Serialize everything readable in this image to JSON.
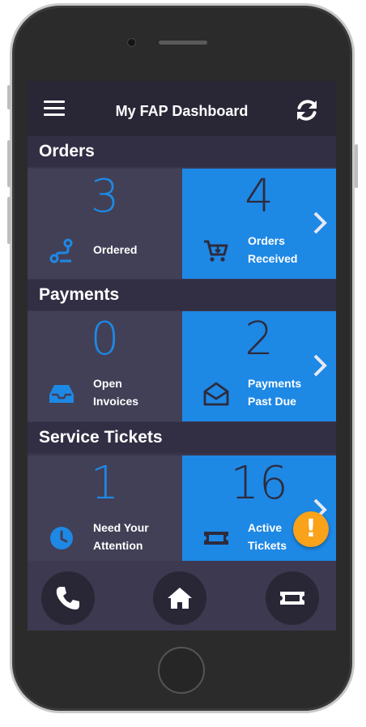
{
  "header": {
    "title": "My FAP Dashboard"
  },
  "sections": [
    {
      "title": "Orders",
      "left": {
        "count": "3",
        "label_line1": "Ordered",
        "label_line2": ""
      },
      "right": {
        "count": "4",
        "label_line1": "Orders",
        "label_line2": "Received"
      }
    },
    {
      "title": "Payments",
      "left": {
        "count": "0",
        "label_line1": "Open",
        "label_line2": "Invoices"
      },
      "right": {
        "count": "2",
        "label_line1": "Payments",
        "label_line2": "Past Due"
      }
    },
    {
      "title": "Service Tickets",
      "left": {
        "count": "1",
        "label_line1": "Need Your",
        "label_line2": "Attention"
      },
      "right": {
        "count": "16",
        "label_line1": "Active",
        "label_line2": "Tickets"
      }
    }
  ],
  "fab": {
    "glyph": "!"
  },
  "colors": {
    "accent_blue": "#1e88e5",
    "header_bg": "#292636",
    "tile_dark": "#424056",
    "alert_orange": "#f9a21a"
  },
  "icons": {
    "menu": "hamburger-icon",
    "refresh": "refresh-icon",
    "ordered": "route-icon",
    "received": "cart-icon",
    "invoices": "inbox-icon",
    "past_due": "envelope-open-icon",
    "attention": "clock-icon",
    "tickets": "ticket-icon",
    "phone": "phone-icon",
    "home": "home-icon",
    "ticket_nav": "ticket-icon"
  }
}
